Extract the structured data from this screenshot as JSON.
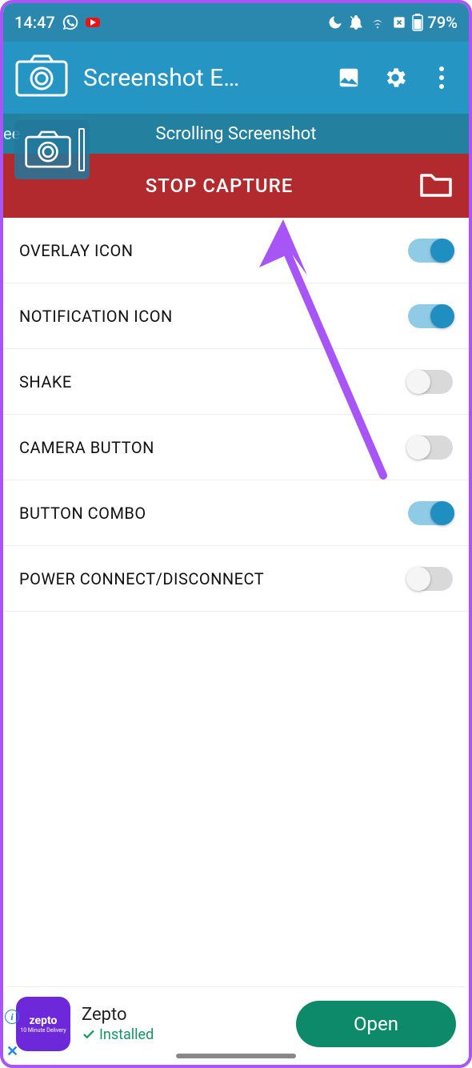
{
  "status": {
    "time": "14:47",
    "battery": "79%"
  },
  "appbar": {
    "title": "Screenshot E…"
  },
  "subbar": {
    "left_fragment": "ee",
    "title": "Scrolling Screenshot"
  },
  "capture": {
    "label": "STOP CAPTURE"
  },
  "settings": [
    {
      "label": "OVERLAY ICON",
      "on": true
    },
    {
      "label": "NOTIFICATION ICON",
      "on": true
    },
    {
      "label": "SHAKE",
      "on": false
    },
    {
      "label": "CAMERA BUTTON",
      "on": false
    },
    {
      "label": "BUTTON COMBO",
      "on": true
    },
    {
      "label": "POWER CONNECT/DISCONNECT",
      "on": false
    }
  ],
  "ad": {
    "brand": "zepto",
    "brand_sub": "10 Minute Delivery",
    "title": "Zepto",
    "installed_label": "Installed",
    "cta": "Open"
  }
}
